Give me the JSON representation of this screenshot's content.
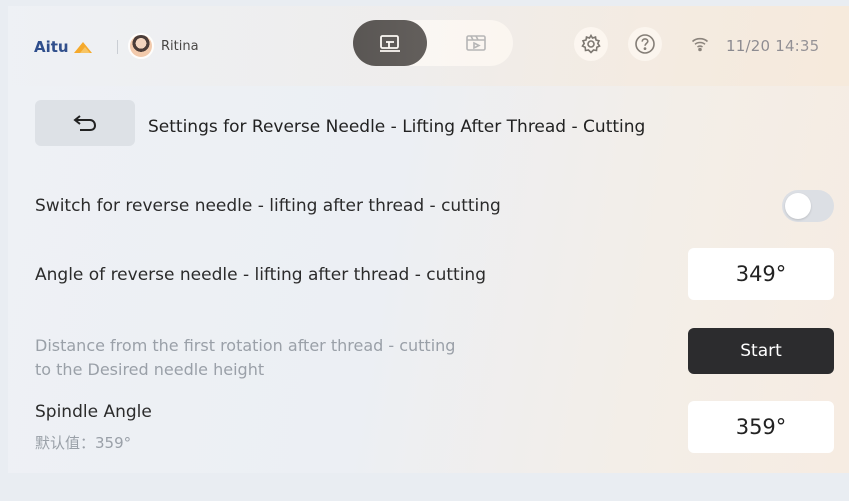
{
  "topbar": {
    "brand": "Aitu",
    "username": "Ritina",
    "datetime": "11/20 14:35",
    "icons": {
      "mode_active": "sewing-machine-icon",
      "mode_inactive": "video-board-icon",
      "settings": "gear-icon",
      "help": "help-icon",
      "wifi": "wifi-icon"
    }
  },
  "header": {
    "back_icon": "back-arrow-icon",
    "title": "Settings for Reverse Needle - Lifting After Thread - Cutting"
  },
  "settings": {
    "switch": {
      "label": "Switch for reverse needle - lifting after thread - cutting",
      "enabled": false
    },
    "angle": {
      "label": "Angle of reverse needle - lifting after thread - cutting",
      "value": "349°"
    },
    "distance": {
      "label_line1": "Distance from the first rotation after thread - cutting",
      "label_line2": "to the Desired needle height",
      "button": "Start"
    },
    "spindle": {
      "label": "Spindle Angle",
      "default_hint": "默认值：359°",
      "value": "359°"
    }
  },
  "colors": {
    "accent_dark": "#2c2c2e",
    "brand_blue": "#2a4a8a",
    "logo_orange": "#f5a623"
  }
}
